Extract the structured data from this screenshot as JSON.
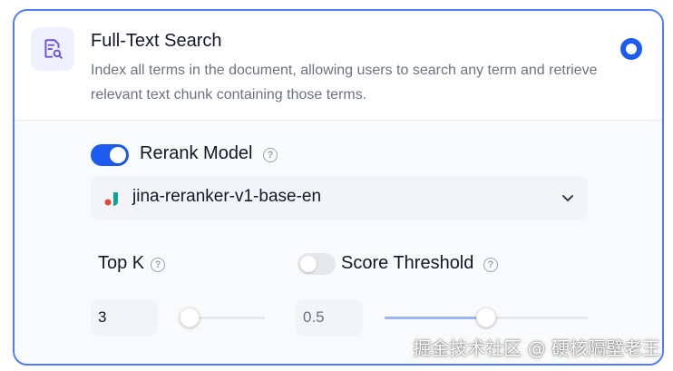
{
  "option": {
    "icon": "file-search-icon",
    "title": "Full-Text Search",
    "description": "Index all terms in the document, allowing users to search any term and retrieve relevant text chunk containing those terms.",
    "selected": true
  },
  "rerank": {
    "enabled": true,
    "label": "Rerank Model",
    "help_icon": "help-circle-icon",
    "model": {
      "name": "jina-reranker-v1-base-en",
      "icon": "jina-logo-icon",
      "dropdown_icon": "chevron-down-icon"
    }
  },
  "top_k": {
    "label": "Top K",
    "help_icon": "help-circle-icon",
    "value": "3",
    "slider_fraction": 0.12
  },
  "score_threshold": {
    "enabled": false,
    "label": "Score Threshold",
    "help_icon": "help-circle-icon",
    "value": "0.5",
    "slider_fraction": 0.5
  },
  "watermark": "掘金技术社区 @ 硬核隔壁老王",
  "colors": {
    "accent": "#1d5bf0",
    "border": "#4f7cf0",
    "slider_active": "#1d5bf0",
    "slider_inactive": "#9db4f5"
  }
}
